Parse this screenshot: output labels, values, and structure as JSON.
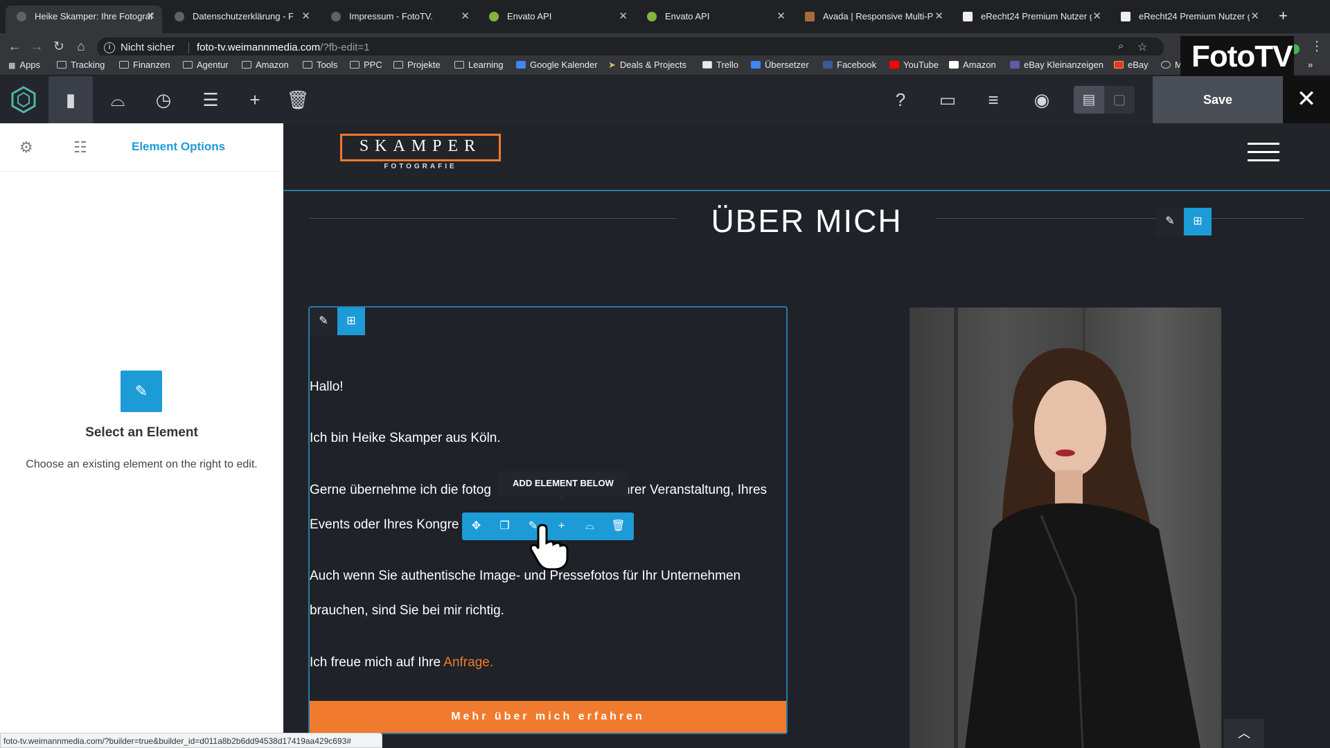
{
  "tabs": [
    {
      "title": "Heike Skamper: Ihre Fotograf",
      "active": true
    },
    {
      "title": "Datenschutzerklärung - Foto"
    },
    {
      "title": "Impressum - FotoTV."
    },
    {
      "title": "Envato API"
    },
    {
      "title": "Envato API"
    },
    {
      "title": "Avada | Responsive Multi-Pu"
    },
    {
      "title": "eRecht24 Premium Nutzer g"
    },
    {
      "title": "eRecht24 Premium Nutzer g"
    }
  ],
  "address": {
    "security": "Nicht sicher",
    "host": "foto-tv.weimannmedia.com",
    "path": "/?fb-edit=1"
  },
  "bookmarks": [
    "Apps",
    "Tracking",
    "Finanzen",
    "Agentur",
    "Amazon",
    "Tools",
    "PPC",
    "Projekte",
    "Learning",
    "Google Kalender",
    "Deals & Projects",
    "Trello",
    "Übersetzer",
    "Facebook",
    "YouTube",
    "Amazon",
    "eBay Kleinanzeigen",
    "eBay",
    "M"
  ],
  "watermark": {
    "text": "FotoTV"
  },
  "builder": {
    "save_label": "Save"
  },
  "panel": {
    "title": "Element Options",
    "select_title": "Select an Element",
    "select_desc": "Choose an existing element on the right to edit."
  },
  "site": {
    "logo": "SKAMPER",
    "logo_sub": "FOTOGRAFIE",
    "heading": "ÜBER MICH",
    "greeting": "Hallo!",
    "intro": "Ich bin Heike Skamper aus Köln.",
    "line1_a": "Gerne übernehme ich die fotog",
    "line1_b": "hrer Veranstaltung, Ihres",
    "line2": "Events oder Ihres Kongre",
    "line3": "Auch wenn Sie authentische Image- und Pressefotos für Ihr Unternehmen",
    "line4": "brauchen, sind Sie bei mir richtig.",
    "line5": "Ich freue mich auf Ihre",
    "link": "Anfrage.",
    "cta": "Mehr über mich erfahren",
    "tooltip": "ADD ELEMENT BELOW"
  },
  "status_url": "foto-tv.weimannmedia.com/?builder=true&builder_id=d011a8b2b6dd94538d17419aa429c693#",
  "colors": {
    "accent": "#1d9bd7",
    "orange": "#f07a2d",
    "dark": "#1f2228"
  }
}
